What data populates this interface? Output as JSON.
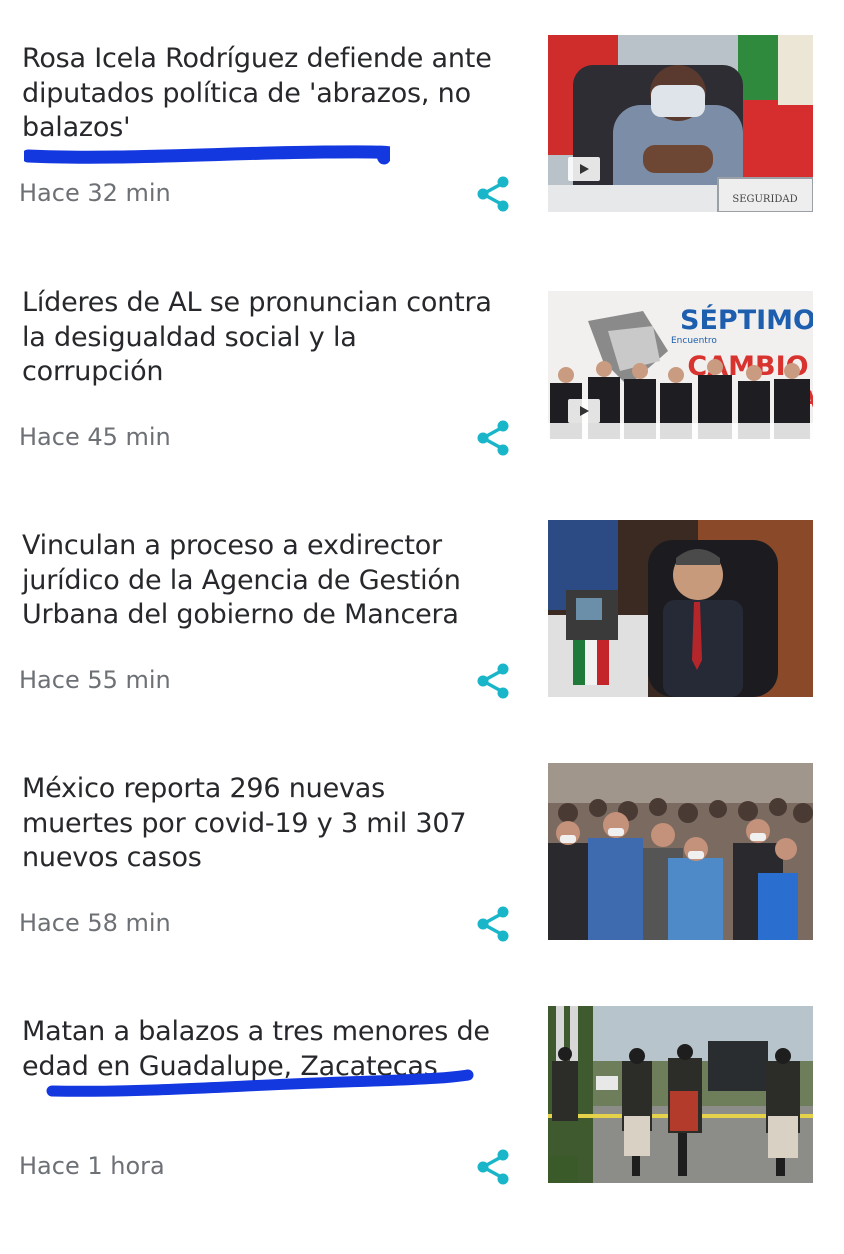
{
  "articles": [
    {
      "headline": "Rosa Icela Rodríguez defiende ante diputados política de 'abrazos, no balazos'",
      "time": "Hace 32 min",
      "has_video": true,
      "image_text": [
        "SEGURIDAD"
      ]
    },
    {
      "headline": "Líderes de AL se pronuncian contra la desigualdad social y la corrupción",
      "time": "Hace 45 min",
      "has_video": true,
      "image_text": [
        "SÉPTIMO",
        "Encuentro",
        "CAMBIO",
        "RA"
      ]
    },
    {
      "headline": "Vinculan a proceso a exdirector jurídico de la Agencia de Gestión Urbana del gobierno de Mancera",
      "time": "Hace 55 min",
      "has_video": false
    },
    {
      "headline": "México reporta 296 nuevas muertes por covid-19 y 3 mil 307 nuevos casos",
      "time": "Hace 58 min",
      "has_video": false
    },
    {
      "headline": "Matan a balazos a tres menores de edad en Guadalupe, Zacatecas",
      "time": "Hace 1 hora",
      "has_video": false
    }
  ],
  "colors": {
    "accent": "#19b6c9",
    "marker": "#1438e0",
    "text": "#26282b",
    "muted": "#6d7175"
  },
  "icons": {
    "share": "share-icon",
    "play": "play-icon"
  }
}
